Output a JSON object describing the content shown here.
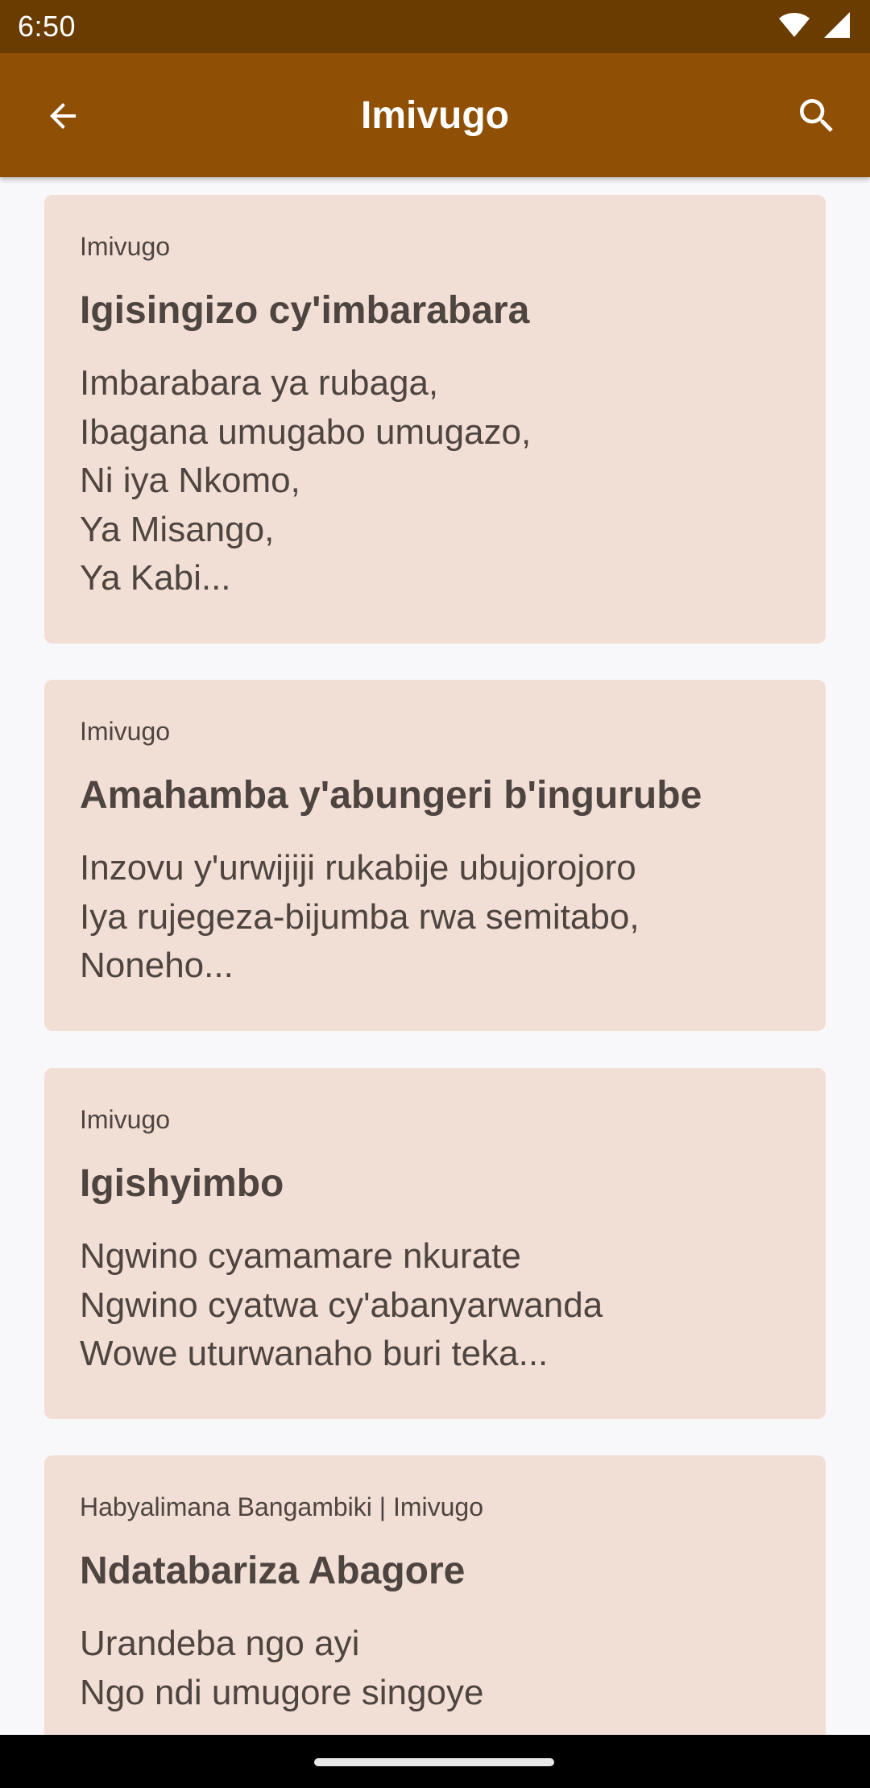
{
  "status_bar": {
    "time": "6:50",
    "icons": [
      "wifi-icon",
      "cell-signal-icon"
    ]
  },
  "app_bar": {
    "title": "Imivugo",
    "back_icon": "arrow-back-icon",
    "search_icon": "search-icon"
  },
  "colors": {
    "status_bar": "#6b3c02",
    "app_bar": "#8f4f04",
    "card_background": "#f1dfd5",
    "card_text": "#4e4440",
    "page_background": "#f8f8fa"
  },
  "cards": [
    {
      "meta": "Imivugo",
      "title": "Igisingizo cy'imbarabara",
      "excerpt": "Imbarabara ya rubaga,\nIbagana umugabo umugazo,\nNi iya Nkomo,\nYa Misango,\nYa Kabi..."
    },
    {
      "meta": "Imivugo",
      "title": "Amahamba y'abungeri b'ingurube",
      "excerpt": "Inzovu y'urwijiji rukabije ubujorojoro\nIya rujegeza-bijumba rwa semitabo,\nNoneho..."
    },
    {
      "meta": "Imivugo",
      "title": "Igishyimbo",
      "excerpt": "Ngwino cyamamare nkurate\nNgwino cyatwa cy'abanyarwanda\nWowe uturwanaho buri teka..."
    },
    {
      "meta": "Habyalimana Bangambiki | Imivugo",
      "title": "Ndatabariza Abagore",
      "excerpt": "Urandeba ngo ayi\nNgo ndi umugore singoye"
    }
  ]
}
